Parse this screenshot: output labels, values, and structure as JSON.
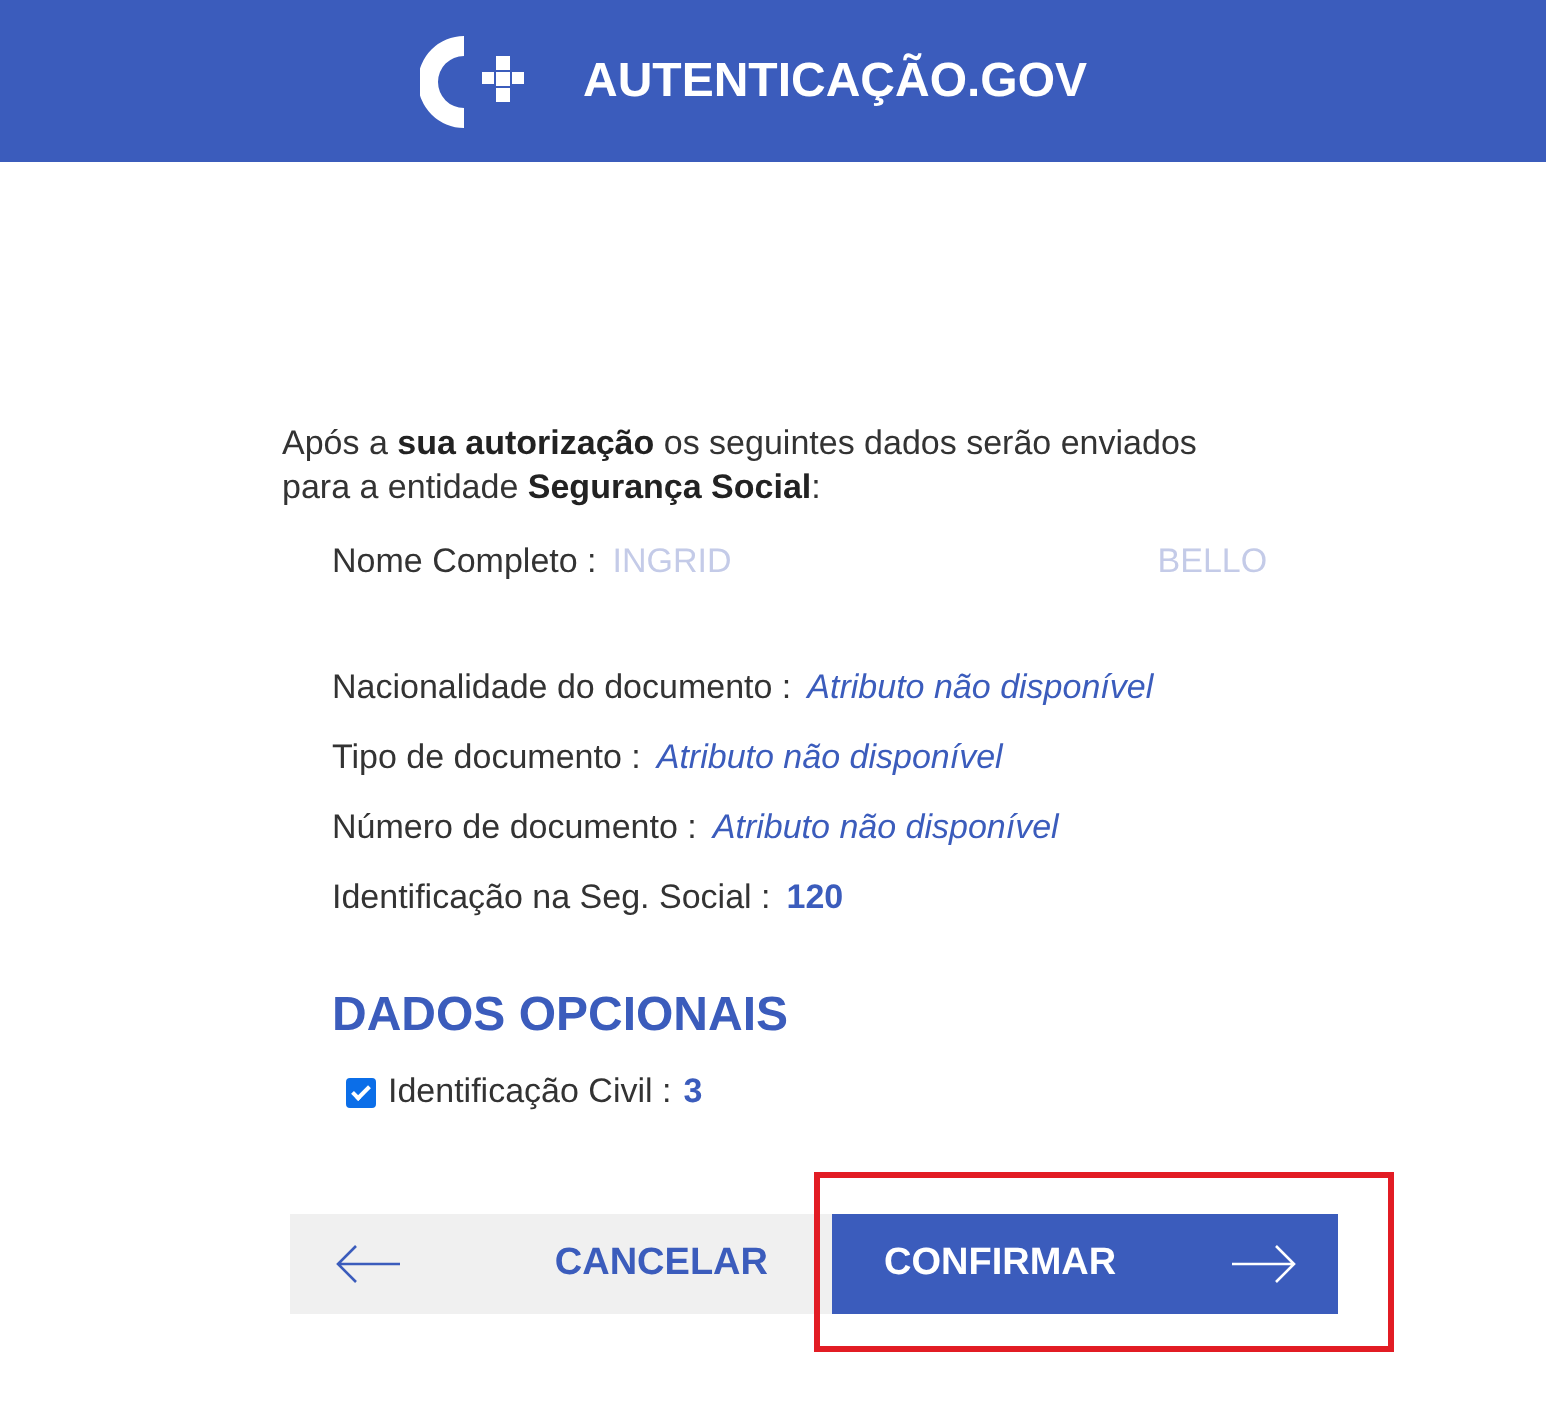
{
  "header": {
    "title": "AUTENTICAÇÃO.GOV"
  },
  "intro": "Após a **sua autorização** os seguintes dados serão enviados para a entidade **Segurança Social**:",
  "fields": [
    {
      "label": "Nome Completo :",
      "kind": "faint",
      "values": [
        "INGRID",
        "BELLO"
      ]
    },
    {
      "label": "Nacionalidade do documento :",
      "kind": "unavailable",
      "values": [
        "Atributo não disponível"
      ]
    },
    {
      "label": "Tipo de documento :",
      "kind": "unavailable",
      "values": [
        "Atributo não disponível"
      ]
    },
    {
      "label": "Número de documento :",
      "kind": "unavailable",
      "values": [
        "Atributo não disponível"
      ]
    },
    {
      "label": "Identificação na Seg. Social :",
      "kind": "value",
      "values": [
        "120"
      ]
    }
  ],
  "optional": {
    "heading": "DADOS OPCIONAIS",
    "items": [
      {
        "label": "Identificação Civil :",
        "value": "3",
        "checked": true
      }
    ]
  },
  "buttons": {
    "cancel": "CANCELAR",
    "confirm": "CONFIRMAR"
  }
}
